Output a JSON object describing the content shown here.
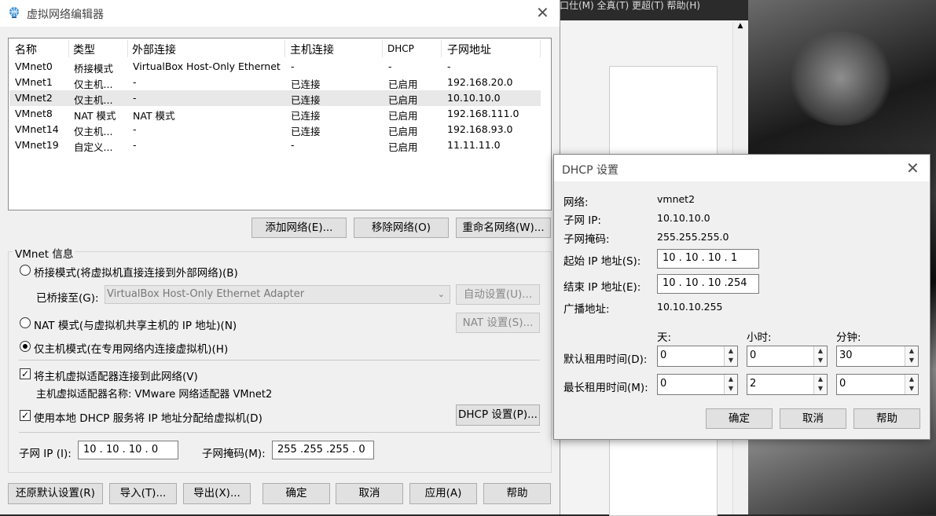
{
  "main": {
    "title": "虚拟网络编辑器",
    "columns": [
      "名称",
      "类型",
      "外部连接",
      "主机连接",
      "DHCP",
      "子网地址"
    ],
    "rows": [
      [
        "VMnet0",
        "桥接模式",
        "VirtualBox Host-Only Ethernet ...",
        "-",
        "-",
        "-"
      ],
      [
        "VMnet1",
        "仅主机...",
        "-",
        "已连接",
        "已启用",
        "192.168.20.0"
      ],
      [
        "VMnet2",
        "仅主机...",
        "-",
        "已连接",
        "已启用",
        "10.10.10.0"
      ],
      [
        "VMnet8",
        "NAT 模式",
        "NAT 模式",
        "已连接",
        "已启用",
        "192.168.111.0"
      ],
      [
        "VMnet14",
        "仅主机...",
        "-",
        "已连接",
        "已启用",
        "192.168.93.0"
      ],
      [
        "VMnet19",
        "自定义...",
        "-",
        "-",
        "已启用",
        "11.11.11.0"
      ]
    ],
    "selected_row": 2,
    "buttons": {
      "add": "添加网络(E)...",
      "remove": "移除网络(O)",
      "rename": "重命名网络(W)..."
    },
    "info": {
      "group_label": "VMnet 信息",
      "bridge_radio": "桥接模式(将虚拟机直接连接到外部网络)(B)",
      "bridged_to_label": "已桥接至(G):",
      "bridged_to_value": "VirtualBox Host-Only Ethernet Adapter",
      "auto_settings": "自动设置(U)...",
      "nat_radio": "NAT 模式(与虚拟机共享主机的 IP 地址)(N)",
      "nat_settings": "NAT 设置(S)...",
      "host_only_radio": "仅主机模式(在专用网络内连接虚拟机)(H)",
      "connect_adapter_check": "将主机虚拟适配器连接到此网络(V)",
      "adapter_name": "主机虚拟适配器名称: VMware 网络适配器 VMnet2",
      "dhcp_check": "使用本地 DHCP 服务将 IP 地址分配给虚拟机(D)",
      "dhcp_settings": "DHCP 设置(P)...",
      "subnet_ip_label": "子网 IP (I):",
      "subnet_ip_value": "10 . 10 . 10 . 0",
      "subnet_mask_label": "子网掩码(M):",
      "subnet_mask_value": "255 .255 .255 . 0"
    },
    "footer": {
      "restore": "还原默认设置(R)",
      "import": "导入(T)...",
      "export": "导出(X)...",
      "ok": "确定",
      "cancel": "取消",
      "apply": "应用(A)",
      "help": "帮助"
    }
  },
  "dhcp": {
    "title": "DHCP 设置",
    "network_label": "网络:",
    "network_value": "vmnet2",
    "subnet_ip_label": "子网 IP:",
    "subnet_ip_value": "10.10.10.0",
    "subnet_mask_label": "子网掩码:",
    "subnet_mask_value": "255.255.255.0",
    "start_ip_label": "起始 IP 地址(S):",
    "start_ip_value": "10 . 10 . 10 . 1",
    "end_ip_label": "结束 IP 地址(E):",
    "end_ip_value": "10 . 10 . 10 .254",
    "broadcast_label": "广播地址:",
    "broadcast_value": "10.10.10.255",
    "day_header": "天:",
    "hour_header": "小时:",
    "minute_header": "分钟:",
    "default_lease_label": "默认租用时间(D):",
    "default_lease": [
      "0",
      "0",
      "30"
    ],
    "max_lease_label": "最长租用时间(M):",
    "max_lease": [
      "0",
      "2",
      "0"
    ],
    "ok": "确定",
    "cancel": "取消",
    "help": "帮助"
  },
  "background": {
    "topbar_text": "口仕(M)    全真(T)    更超(T)    帮助(H)"
  }
}
